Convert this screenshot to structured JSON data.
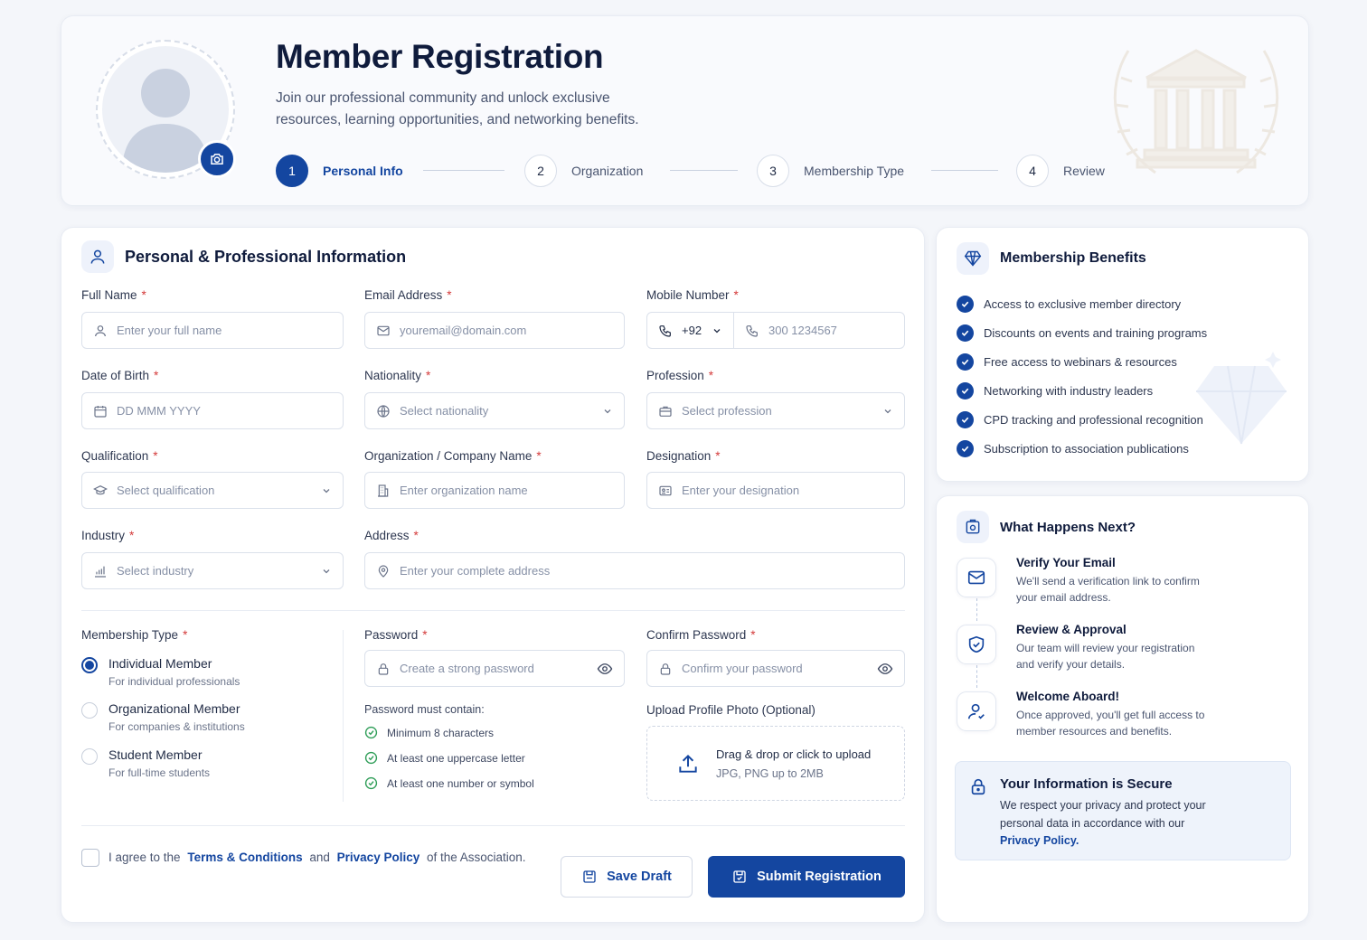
{
  "header": {
    "title": "Member Registration",
    "subtitle": "Join our professional community and unlock exclusive resources, learning opportunities, and networking benefits.",
    "steps": [
      {
        "num": "1",
        "label": "Personal Info",
        "active": true
      },
      {
        "num": "2",
        "label": "Organization",
        "active": false
      },
      {
        "num": "3",
        "label": "Membership Type",
        "active": false
      },
      {
        "num": "4",
        "label": "Review",
        "active": false
      }
    ]
  },
  "form": {
    "section_title": "Personal & Professional Information",
    "fields": {
      "full_name": {
        "label": "Full Name",
        "placeholder": "Enter your full name"
      },
      "email": {
        "label": "Email Address",
        "placeholder": "youremail@domain.com"
      },
      "mobile": {
        "label": "Mobile Number",
        "country_code": "+92",
        "placeholder": "300 1234567"
      },
      "dob": {
        "label": "Date of Birth",
        "placeholder": "DD MMM YYYY"
      },
      "nationality": {
        "label": "Nationality",
        "placeholder": "Select nationality"
      },
      "profession": {
        "label": "Profession",
        "placeholder": "Select profession"
      },
      "qualification": {
        "label": "Qualification",
        "placeholder": "Select qualification"
      },
      "organization": {
        "label": "Organization / Company Name",
        "placeholder": "Enter organization name"
      },
      "designation": {
        "label": "Designation",
        "placeholder": "Enter your designation"
      },
      "industry": {
        "label": "Industry",
        "placeholder": "Select industry"
      },
      "address": {
        "label": "Address",
        "placeholder": "Enter your complete address"
      },
      "password": {
        "label": "Password",
        "placeholder": "Create a strong password"
      },
      "confirm_password": {
        "label": "Confirm Password",
        "placeholder": "Confirm your password"
      }
    },
    "required_mark": "*",
    "membership": {
      "label": "Membership Type",
      "options": [
        {
          "title": "Individual Member",
          "desc": "For individual professionals",
          "selected": true
        },
        {
          "title": "Organizational Member",
          "desc": "For companies & institutions",
          "selected": false
        },
        {
          "title": "Student Member",
          "desc": "For full-time students",
          "selected": false
        }
      ]
    },
    "password_rules": {
      "title": "Password must contain:",
      "items": [
        "Minimum 8 characters",
        "At least one uppercase letter",
        "At least one number or symbol"
      ]
    },
    "upload": {
      "label": "Upload Profile Photo (Optional)",
      "title": "Drag & drop or click to upload",
      "hint": "JPG, PNG up to 2MB"
    },
    "agree": {
      "prefix": "I agree to the",
      "terms": "Terms & Conditions",
      "and": "and",
      "privacy": "Privacy Policy",
      "suffix": "of the Association."
    },
    "buttons": {
      "save": "Save Draft",
      "submit": "Submit Registration"
    }
  },
  "benefits": {
    "title": "Membership Benefits",
    "items": [
      "Access to exclusive member directory",
      "Discounts on events and training programs",
      "Free access to webinars & resources",
      "Networking with industry leaders",
      "CPD tracking and professional recognition",
      "Subscription to association publications"
    ]
  },
  "next": {
    "title": "What Happens Next?",
    "steps": [
      {
        "icon": "mail-icon",
        "title": "Verify Your Email",
        "desc": "We'll send a verification link to confirm your email address."
      },
      {
        "icon": "shield-check-icon",
        "title": "Review & Approval",
        "desc": "Our team will review your registration and verify your details."
      },
      {
        "icon": "user-check-icon",
        "title": "Welcome Aboard!",
        "desc": "Once approved, you'll get full access to member resources and benefits."
      }
    ],
    "secure": {
      "title": "Your Information is Secure",
      "desc": "We respect your privacy and protect your personal data in accordance with our",
      "link": "Privacy Policy."
    }
  },
  "colors": {
    "primary": "#1446a0",
    "required": "#d43a3a",
    "success": "#2e9d57",
    "background": "#f4f6fa"
  }
}
